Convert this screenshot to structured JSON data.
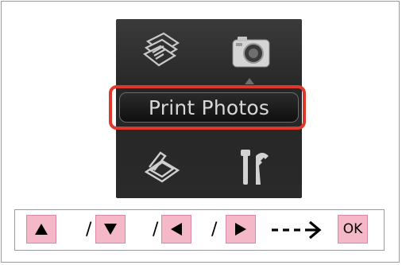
{
  "lcd": {
    "selected_menu": "Print Photos",
    "icons": [
      "copy-icon",
      "camera-icon",
      "scan-icon",
      "setup-icon"
    ]
  },
  "instructions": {
    "keys": [
      "up-arrow",
      "down-arrow",
      "left-arrow",
      "right-arrow"
    ],
    "separator": "/",
    "ok_label": "OK"
  },
  "colors": {
    "highlight": "#e0372b",
    "key_fill": "#f4b8c8",
    "screen": "#2e2e2e"
  }
}
